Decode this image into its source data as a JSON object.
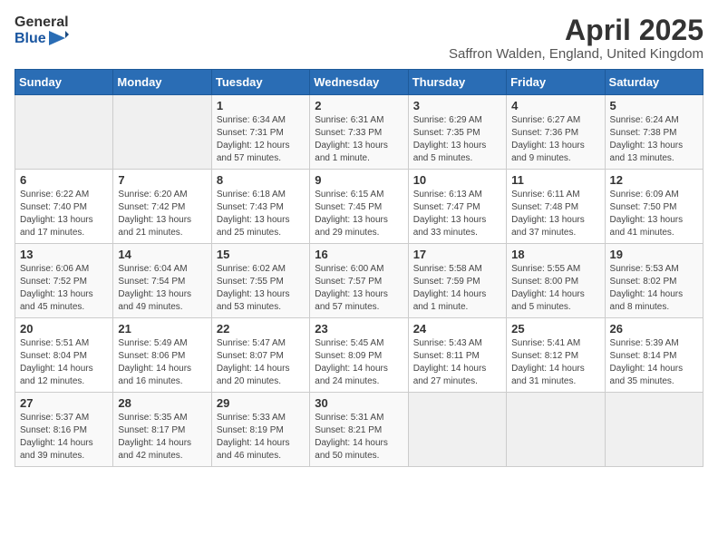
{
  "header": {
    "logo_general": "General",
    "logo_blue": "Blue",
    "title": "April 2025",
    "subtitle": "Saffron Walden, England, United Kingdom"
  },
  "days_of_week": [
    "Sunday",
    "Monday",
    "Tuesday",
    "Wednesday",
    "Thursday",
    "Friday",
    "Saturday"
  ],
  "weeks": [
    [
      {
        "day": "",
        "info": ""
      },
      {
        "day": "",
        "info": ""
      },
      {
        "day": "1",
        "info": "Sunrise: 6:34 AM\nSunset: 7:31 PM\nDaylight: 12 hours and 57 minutes."
      },
      {
        "day": "2",
        "info": "Sunrise: 6:31 AM\nSunset: 7:33 PM\nDaylight: 13 hours and 1 minute."
      },
      {
        "day": "3",
        "info": "Sunrise: 6:29 AM\nSunset: 7:35 PM\nDaylight: 13 hours and 5 minutes."
      },
      {
        "day": "4",
        "info": "Sunrise: 6:27 AM\nSunset: 7:36 PM\nDaylight: 13 hours and 9 minutes."
      },
      {
        "day": "5",
        "info": "Sunrise: 6:24 AM\nSunset: 7:38 PM\nDaylight: 13 hours and 13 minutes."
      }
    ],
    [
      {
        "day": "6",
        "info": "Sunrise: 6:22 AM\nSunset: 7:40 PM\nDaylight: 13 hours and 17 minutes."
      },
      {
        "day": "7",
        "info": "Sunrise: 6:20 AM\nSunset: 7:42 PM\nDaylight: 13 hours and 21 minutes."
      },
      {
        "day": "8",
        "info": "Sunrise: 6:18 AM\nSunset: 7:43 PM\nDaylight: 13 hours and 25 minutes."
      },
      {
        "day": "9",
        "info": "Sunrise: 6:15 AM\nSunset: 7:45 PM\nDaylight: 13 hours and 29 minutes."
      },
      {
        "day": "10",
        "info": "Sunrise: 6:13 AM\nSunset: 7:47 PM\nDaylight: 13 hours and 33 minutes."
      },
      {
        "day": "11",
        "info": "Sunrise: 6:11 AM\nSunset: 7:48 PM\nDaylight: 13 hours and 37 minutes."
      },
      {
        "day": "12",
        "info": "Sunrise: 6:09 AM\nSunset: 7:50 PM\nDaylight: 13 hours and 41 minutes."
      }
    ],
    [
      {
        "day": "13",
        "info": "Sunrise: 6:06 AM\nSunset: 7:52 PM\nDaylight: 13 hours and 45 minutes."
      },
      {
        "day": "14",
        "info": "Sunrise: 6:04 AM\nSunset: 7:54 PM\nDaylight: 13 hours and 49 minutes."
      },
      {
        "day": "15",
        "info": "Sunrise: 6:02 AM\nSunset: 7:55 PM\nDaylight: 13 hours and 53 minutes."
      },
      {
        "day": "16",
        "info": "Sunrise: 6:00 AM\nSunset: 7:57 PM\nDaylight: 13 hours and 57 minutes."
      },
      {
        "day": "17",
        "info": "Sunrise: 5:58 AM\nSunset: 7:59 PM\nDaylight: 14 hours and 1 minute."
      },
      {
        "day": "18",
        "info": "Sunrise: 5:55 AM\nSunset: 8:00 PM\nDaylight: 14 hours and 5 minutes."
      },
      {
        "day": "19",
        "info": "Sunrise: 5:53 AM\nSunset: 8:02 PM\nDaylight: 14 hours and 8 minutes."
      }
    ],
    [
      {
        "day": "20",
        "info": "Sunrise: 5:51 AM\nSunset: 8:04 PM\nDaylight: 14 hours and 12 minutes."
      },
      {
        "day": "21",
        "info": "Sunrise: 5:49 AM\nSunset: 8:06 PM\nDaylight: 14 hours and 16 minutes."
      },
      {
        "day": "22",
        "info": "Sunrise: 5:47 AM\nSunset: 8:07 PM\nDaylight: 14 hours and 20 minutes."
      },
      {
        "day": "23",
        "info": "Sunrise: 5:45 AM\nSunset: 8:09 PM\nDaylight: 14 hours and 24 minutes."
      },
      {
        "day": "24",
        "info": "Sunrise: 5:43 AM\nSunset: 8:11 PM\nDaylight: 14 hours and 27 minutes."
      },
      {
        "day": "25",
        "info": "Sunrise: 5:41 AM\nSunset: 8:12 PM\nDaylight: 14 hours and 31 minutes."
      },
      {
        "day": "26",
        "info": "Sunrise: 5:39 AM\nSunset: 8:14 PM\nDaylight: 14 hours and 35 minutes."
      }
    ],
    [
      {
        "day": "27",
        "info": "Sunrise: 5:37 AM\nSunset: 8:16 PM\nDaylight: 14 hours and 39 minutes."
      },
      {
        "day": "28",
        "info": "Sunrise: 5:35 AM\nSunset: 8:17 PM\nDaylight: 14 hours and 42 minutes."
      },
      {
        "day": "29",
        "info": "Sunrise: 5:33 AM\nSunset: 8:19 PM\nDaylight: 14 hours and 46 minutes."
      },
      {
        "day": "30",
        "info": "Sunrise: 5:31 AM\nSunset: 8:21 PM\nDaylight: 14 hours and 50 minutes."
      },
      {
        "day": "",
        "info": ""
      },
      {
        "day": "",
        "info": ""
      },
      {
        "day": "",
        "info": ""
      }
    ]
  ]
}
